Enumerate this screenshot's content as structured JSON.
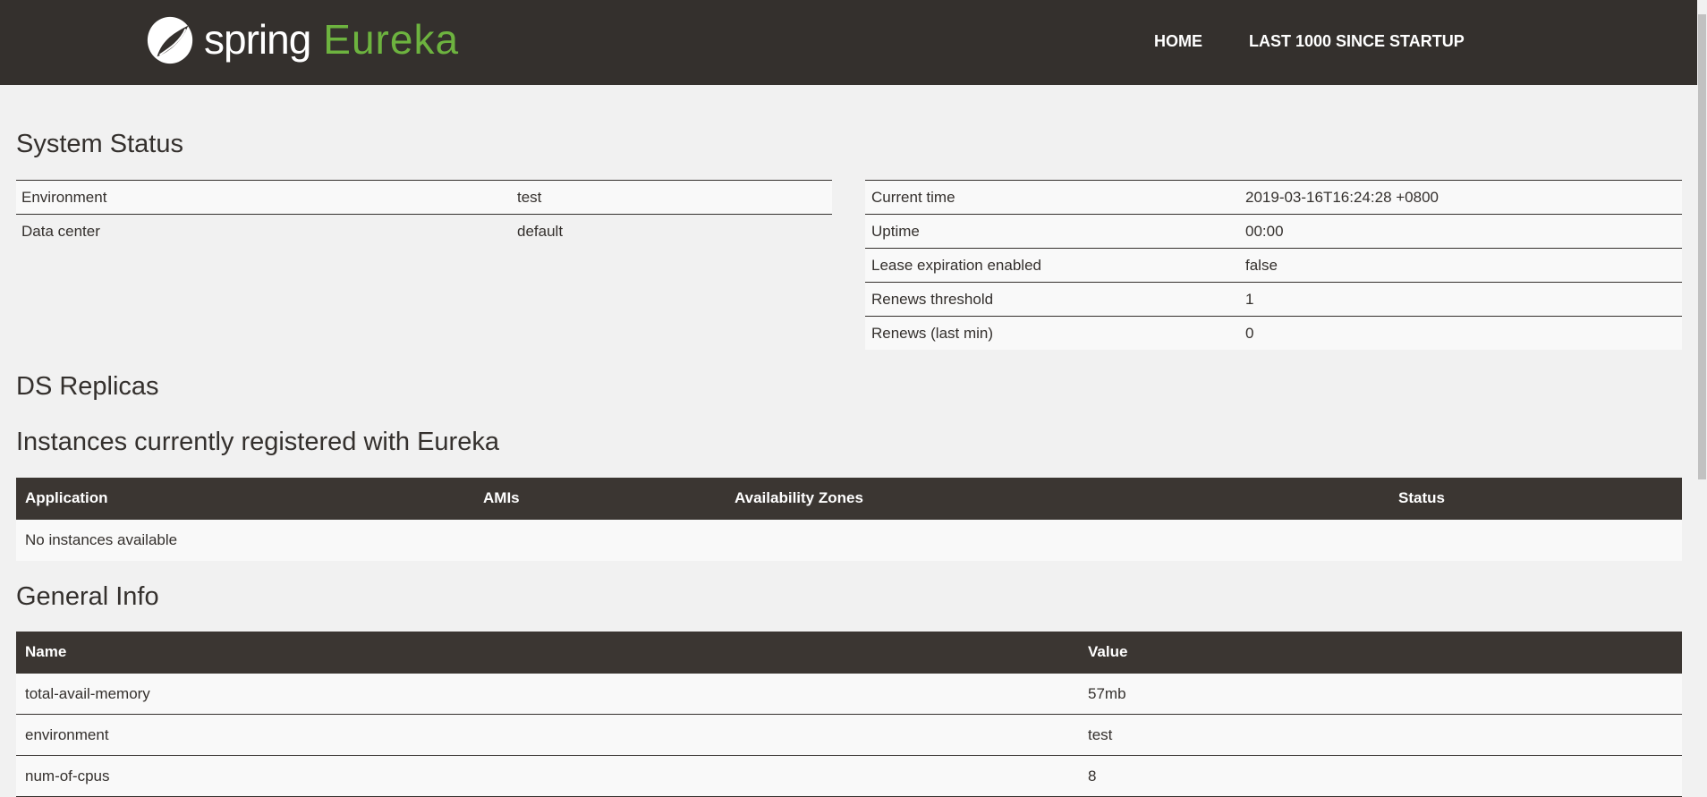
{
  "nav": {
    "logo_spring": "spring",
    "logo_eureka": "Eureka",
    "home": "HOME",
    "last1000": "LAST 1000 SINCE STARTUP"
  },
  "system_status": {
    "title": "System Status",
    "left": [
      {
        "k": "Environment",
        "v": "test"
      },
      {
        "k": "Data center",
        "v": "default"
      }
    ],
    "right": [
      {
        "k": "Current time",
        "v": "2019-03-16T16:24:28 +0800"
      },
      {
        "k": "Uptime",
        "v": "00:00"
      },
      {
        "k": "Lease expiration enabled",
        "v": "false"
      },
      {
        "k": "Renews threshold",
        "v": "1"
      },
      {
        "k": "Renews (last min)",
        "v": "0"
      }
    ]
  },
  "ds_replicas": {
    "title": "DS Replicas"
  },
  "instances": {
    "title": "Instances currently registered with Eureka",
    "headers": [
      "Application",
      "AMIs",
      "Availability Zones",
      "Status"
    ],
    "empty": "No instances available"
  },
  "general_info": {
    "title": "General Info",
    "headers": [
      "Name",
      "Value"
    ],
    "rows": [
      {
        "k": "total-avail-memory",
        "v": "57mb"
      },
      {
        "k": "environment",
        "v": "test"
      },
      {
        "k": "num-of-cpus",
        "v": "8"
      }
    ]
  }
}
